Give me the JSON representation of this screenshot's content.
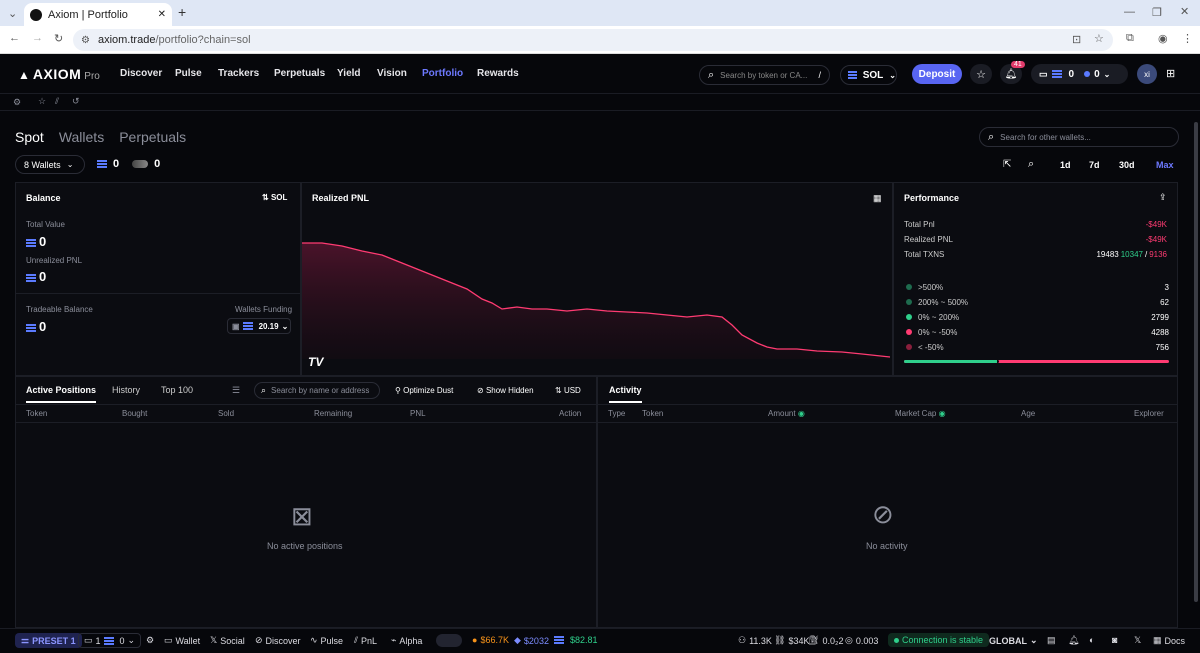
{
  "browser": {
    "tab_title": "Axiom | Portfolio",
    "url_host": "axiom.trade",
    "url_path": "/portfolio?chain=sol"
  },
  "nav": {
    "logo": "AXIOM",
    "logo_sub": "Pro",
    "items": [
      "Discover",
      "Pulse",
      "Trackers",
      "Perpetuals",
      "Yield",
      "Vision",
      "Portfolio",
      "Rewards"
    ],
    "active": "Portfolio",
    "search_placeholder": "Search by token or CA...",
    "search_shortcut": "/",
    "chain": "SOL",
    "deposit": "Deposit",
    "notif_count": "41",
    "wallet_sol": "0",
    "wallet_other": "0",
    "avatar": "xi",
    "accent": "#5865f2"
  },
  "portfolio": {
    "tabs": [
      "Spot",
      "Wallets",
      "Perpetuals"
    ],
    "active_tab": "Spot",
    "search_placeholder": "Search for other wallets...",
    "wallets_label": "8 Wallets",
    "sol_count": "0",
    "other_count": "0",
    "ranges": [
      "1d",
      "7d",
      "30d",
      "Max"
    ],
    "active_range": "Max"
  },
  "balance": {
    "title": "Balance",
    "toggle": "SOL",
    "total_value_label": "Total Value",
    "total_value": "0",
    "unrealized_label": "Unrealized PNL",
    "unrealized": "0",
    "tradeable_label": "Tradeable Balance",
    "tradeable": "0",
    "funding_label": "Wallets Funding",
    "funding_value": "20.19"
  },
  "pnl": {
    "title": "Realized PNL",
    "line_color": "#ff3b72",
    "watermark": "TV"
  },
  "performance": {
    "title": "Performance",
    "total_pnl_label": "Total Pnl",
    "total_pnl": "-$49K",
    "realized_label": "Realized PNL",
    "realized": "-$49K",
    "txns_label": "Total TXNS",
    "txns_total": "19483",
    "txns_buy": "10347",
    "txns_sep": "/",
    "txns_sell": "9136",
    "buckets": [
      {
        "label": ">500%",
        "count": "3",
        "color": "#1e6b4e"
      },
      {
        "label": "200% ~ 500%",
        "count": "62",
        "color": "#1e6b4e"
      },
      {
        "label": "0% ~ 200%",
        "count": "2799",
        "color": "#2fcf8b"
      },
      {
        "label": "0% ~ -50%",
        "count": "4288",
        "color": "#ff3b72"
      },
      {
        "label": "< -50%",
        "count": "756",
        "color": "#8a1f3c"
      }
    ],
    "bar_buy_fraction": 0.36
  },
  "positions": {
    "tabs": [
      "Active Positions",
      "History",
      "Top 100"
    ],
    "active_tab": "Active Positions",
    "search_placeholder": "Search by name or address",
    "optimize": "Optimize Dust",
    "show_hidden": "Show Hidden",
    "currency": "USD",
    "columns": [
      "Token",
      "Bought",
      "Sold",
      "Remaining",
      "PNL",
      "Action"
    ],
    "empty": "No active positions"
  },
  "activity": {
    "title": "Activity",
    "columns": [
      "Type",
      "Token",
      "Amount",
      "Market Cap",
      "Age",
      "Explorer"
    ],
    "empty": "No activity"
  },
  "footer": {
    "preset": "PRESET 1",
    "wallets": "1",
    "wallet_sol": "0",
    "wallet": "Wallet",
    "social": "Social",
    "discover": "Discover",
    "pulse": "Pulse",
    "pnl": "PnL",
    "alpha": "Alpha",
    "btc": "$66.7K",
    "eth": "$2032",
    "sol": "$82.81",
    "holders": "11.3K",
    "mcap": "$34K",
    "gas": "0.0₂2",
    "fee": "0.003",
    "connection": "Connection is stable",
    "region": "GLOBAL",
    "docs": "Docs"
  }
}
